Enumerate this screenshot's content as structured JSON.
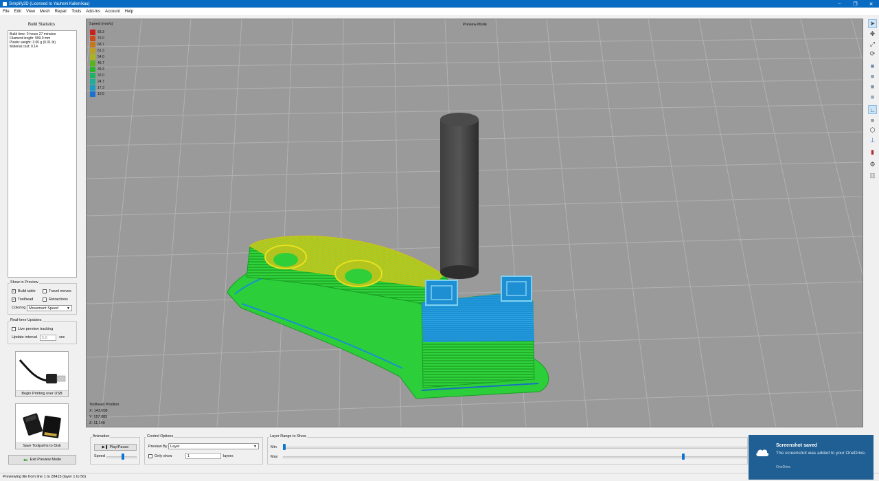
{
  "window": {
    "title": "Simplify3D (Licensed to Yauheni Kaleinikau)",
    "controls": [
      "–",
      "❐",
      "✕"
    ]
  },
  "menu": [
    "File",
    "Edit",
    "View",
    "Mesh",
    "Repair",
    "Tools",
    "Add-Ins",
    "Account",
    "Help"
  ],
  "build_statistics": {
    "title": "Build Statistics",
    "lines": [
      "Build time: 0 hours 27 minutes",
      "Filament length: 999.0 mm",
      "Plastic weight: 3.00 g (0.01 lb)",
      "Material cost: 0.14"
    ]
  },
  "show_in_preview": {
    "title": "Show in Preview",
    "build_table": {
      "label": "Build table",
      "checked": true
    },
    "travel_moves": {
      "label": "Travel moves",
      "checked": false
    },
    "toolhead": {
      "label": "Toolhead",
      "checked": true
    },
    "retractions": {
      "label": "Retractions",
      "checked": false
    },
    "coloring_label": "Coloring",
    "coloring_value": "Movement Speed"
  },
  "realtime": {
    "title": "Real-time Updates",
    "live_label": "Live preview tracking",
    "interval_label": "Update interval",
    "interval_value": "5.0",
    "interval_unit": "sec"
  },
  "actions": {
    "usb_label": "Begin Printing over USB",
    "sd_label": "Save Toolpaths to Disk",
    "exit_label": "Exit Preview Mode"
  },
  "viewport": {
    "mode": "Preview Mode",
    "legend_title": "Speed (mm/s)",
    "legend": [
      {
        "value": "83.3",
        "color": "#c8201c"
      },
      {
        "value": "76.0",
        "color": "#cc4a1c"
      },
      {
        "value": "68.7",
        "color": "#c8781c"
      },
      {
        "value": "61.3",
        "color": "#bca21c"
      },
      {
        "value": "54.0",
        "color": "#a8b61c"
      },
      {
        "value": "46.7",
        "color": "#58b41c"
      },
      {
        "value": "39.3",
        "color": "#28b42c"
      },
      {
        "value": "32.0",
        "color": "#1cb460"
      },
      {
        "value": "24.7",
        "color": "#1cae96"
      },
      {
        "value": "17.3",
        "color": "#1c9cc4"
      },
      {
        "value": "10.0",
        "color": "#1c70d0"
      }
    ],
    "toolhead_title": "Toolhead Position",
    "toolhead_x": "X: 143.008",
    "toolhead_y": "Y: 157.085",
    "toolhead_z": "Z: 11.140"
  },
  "animation": {
    "title": "Animation",
    "play_label": "Play/Pause",
    "speed_label": "Speed"
  },
  "control_options": {
    "title": "Control Options",
    "preview_by_label": "Preview By",
    "preview_by_value": "Layer",
    "only_show_label": "Only show",
    "only_show_value": "1",
    "layers_label": "layers"
  },
  "layer_range": {
    "title": "Layer Range to Show",
    "min_label": "Min",
    "max_label": "Max"
  },
  "status": "Previewing file from line 1 to 28415 (layer 1 to 56)",
  "toast": {
    "title": "Screenshot saved",
    "message": "The screenshot was added to your OneDrive.",
    "app": "OneDrive"
  }
}
